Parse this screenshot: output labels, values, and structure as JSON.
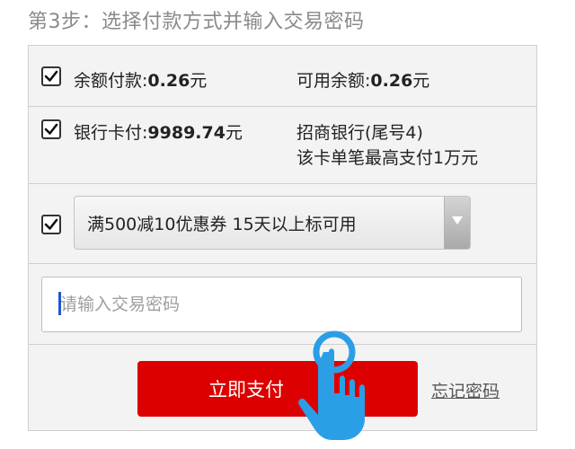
{
  "step_title": "第3步：选择付款方式并输入交易密码",
  "balance_row": {
    "checked": true,
    "label_prefix": "余额付款:",
    "label_amount": "0.26",
    "label_unit": "元",
    "available_prefix": "可用余额:",
    "available_amount": "0.26",
    "available_unit": "元"
  },
  "card_row": {
    "checked": true,
    "label_prefix": "银行卡付:",
    "label_amount": "9989.74",
    "label_unit": "元",
    "bank_info": "招商银行(尾号4)",
    "limit_prefix": "该卡单笔最高支付",
    "limit_amount": "1",
    "limit_unit": "万元"
  },
  "coupon_row": {
    "checked": true,
    "selected_option": "满500减10优惠券 15天以上标可用"
  },
  "password": {
    "placeholder": "请输入交易密码",
    "value": ""
  },
  "actions": {
    "pay_label": "立即支付",
    "forgot_label": "忘记密码"
  },
  "colors": {
    "pay_button": "#dd0000",
    "hand_icon": "#2b9fe6",
    "caret": "#1f55d6"
  },
  "icons": {
    "checkbox": "checkmark-icon",
    "select": "triangle-down-icon",
    "pointer": "hand-tap-icon"
  }
}
